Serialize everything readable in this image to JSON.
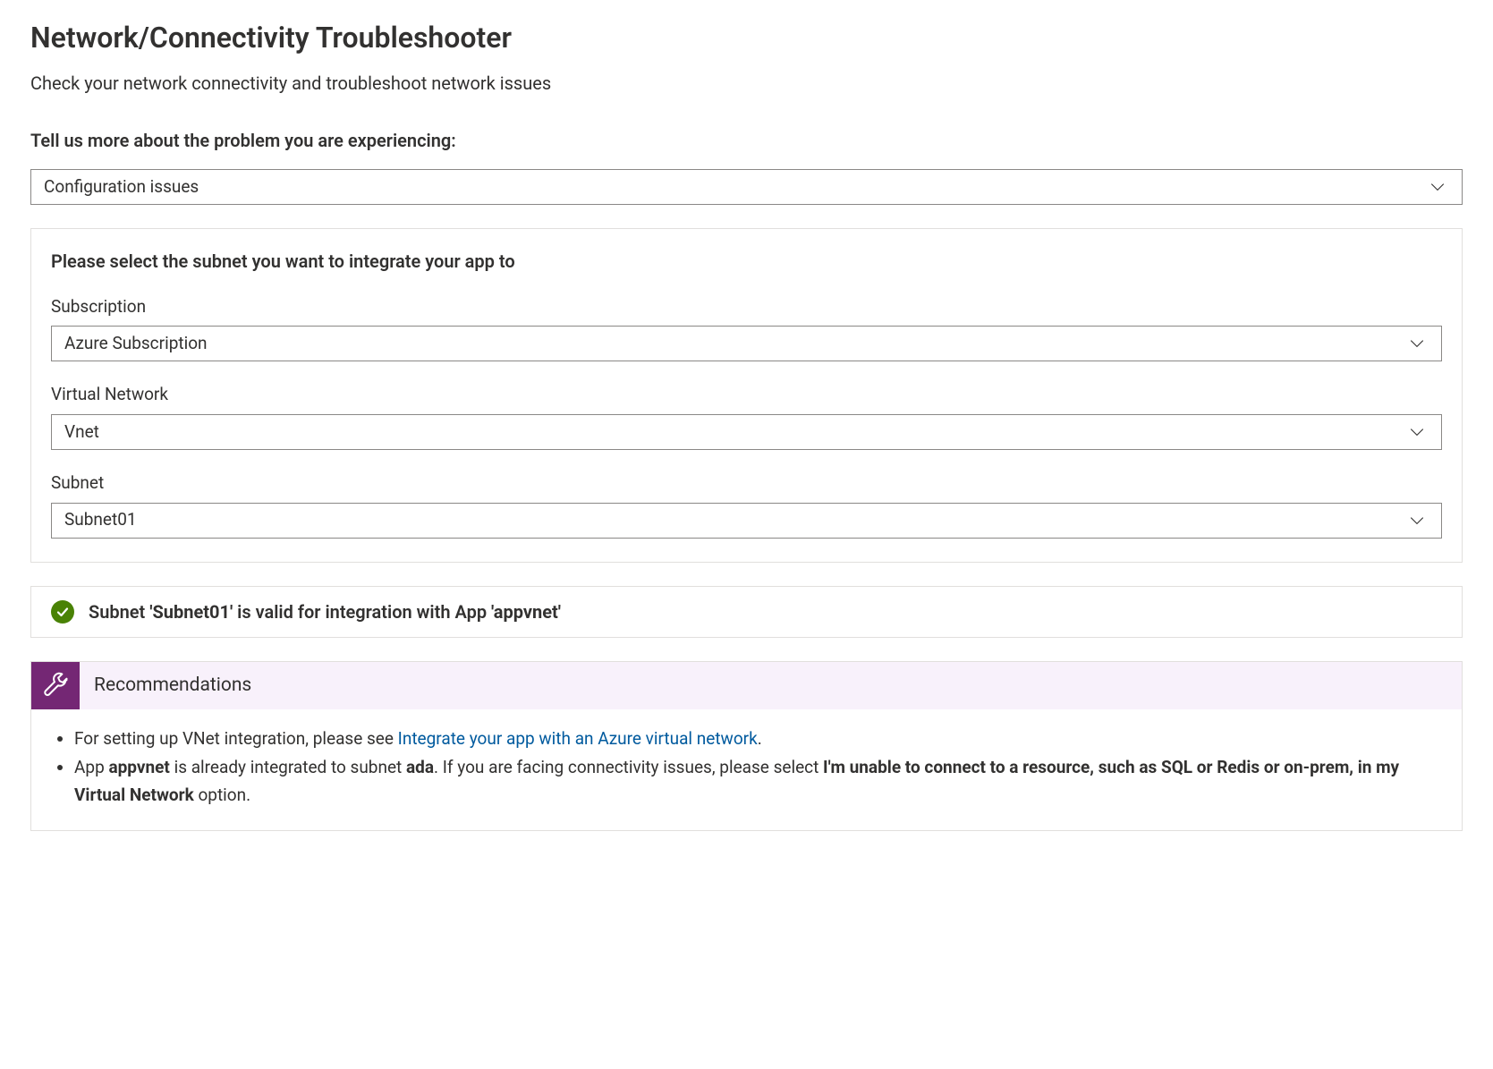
{
  "header": {
    "title": "Network/Connectivity Troubleshooter",
    "subtitle": "Check your network connectivity and troubleshoot network issues"
  },
  "prompt": {
    "label": "Tell us more about the problem you are experiencing:"
  },
  "problem_select": {
    "value": "Configuration issues"
  },
  "subnet_panel": {
    "heading": "Please select the subnet you want to integrate your app to",
    "subscription": {
      "label": "Subscription",
      "value": "Azure Subscription"
    },
    "vnet": {
      "label": "Virtual Network",
      "value": "Vnet"
    },
    "subnet": {
      "label": "Subnet",
      "value": "Subnet01"
    }
  },
  "status": {
    "prefix": "Subnet ",
    "subnet_quoted": "'Subnet01'",
    "middle": " is valid for integration with App ",
    "app_quoted": "'appvnet'"
  },
  "recommendations": {
    "title": "Recommendations",
    "item1": {
      "pre": "For setting up VNet integration, please see ",
      "link": "Integrate your app with an Azure virtual network",
      "post": "."
    },
    "item2": {
      "t1": "App ",
      "b1": "appvnet",
      "t2": " is already integrated to subnet ",
      "b2": "ada",
      "t3": ". If you are facing connectivity issues, please select ",
      "b3": "I'm unable to connect to a resource, such as SQL or Redis or on-prem, in my Virtual Network",
      "t4": " option."
    }
  }
}
